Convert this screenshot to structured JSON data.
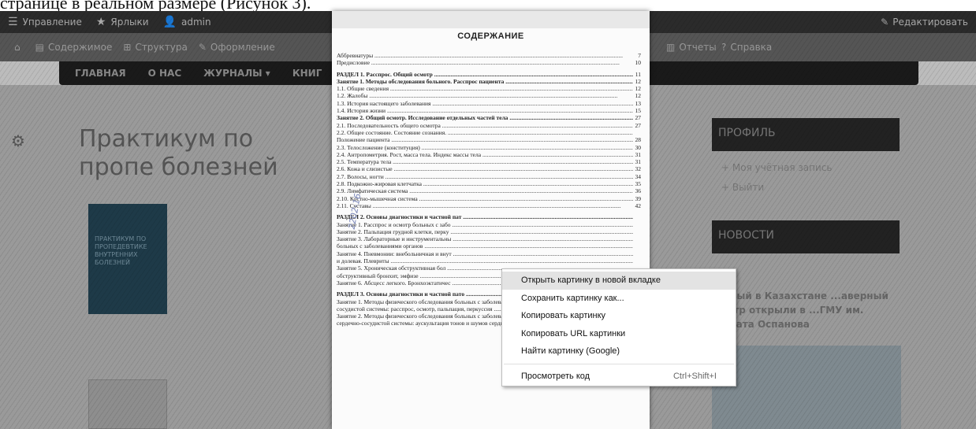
{
  "caption": "странице в реальном размере (Рисунок 3).",
  "admin_toolbar": {
    "items": [
      {
        "icon": "hamburger-icon",
        "label": "Управление"
      },
      {
        "icon": "star-icon",
        "label": "Ярлыки"
      },
      {
        "icon": "user-icon",
        "label": "admin"
      }
    ],
    "edit": {
      "icon": "pencil-icon",
      "label": "Редактировать"
    }
  },
  "admin_tabs": {
    "left": [
      {
        "icon": "home-icon",
        "label": ""
      },
      {
        "icon": "content-icon",
        "label": "Содержимое"
      },
      {
        "icon": "structure-icon",
        "label": "Структура"
      },
      {
        "icon": "appearance-icon",
        "label": "Оформление"
      }
    ],
    "right": [
      {
        "icon": "reports-icon",
        "label": "Отчеты"
      },
      {
        "icon": "help-icon",
        "label": "Справка"
      }
    ]
  },
  "site_nav": [
    "ГЛАВНАЯ",
    "О НАС",
    "ЖУРНАЛЫ ▾",
    "КНИГ"
  ],
  "page_title": "Практикум по пропедевтике внутренних болезней",
  "page_title_visible": "Практикум по пропе болезней",
  "book_cover_text": "ПРАКТИКУМ ПО ПРОПЕДЕВТИКЕ ВНУТРЕННИХ БОЛЕЗНЕЙ",
  "sidebar": {
    "profile_heading": "ПРОФИЛЬ",
    "profile_links": [
      "+ Моя учётная запись",
      "+ Выйти"
    ],
    "news_heading": "НОВОСТИ",
    "news_text": "...овый в Казахстане ...аверный центр открыли в ...ГМУ им. Марата Оспанова"
  },
  "toc": {
    "title": "СОДЕРЖАНИЕ",
    "stamp": "2202-16",
    "lines": [
      {
        "text": "Аббревиатуры",
        "page": "7",
        "cls": ""
      },
      {
        "text": "Предисловие",
        "page": "10",
        "cls": ""
      },
      {
        "text": "РАЗДЕЛ 1. Расспрос. Общий осмотр",
        "page": "11",
        "cls": "gap"
      },
      {
        "text": "Занятие 1. Методы обследования больного. Расспрос пациента",
        "page": "12",
        "cls": ""
      },
      {
        "text": "   1.1. Общие сведения",
        "page": "12",
        "cls": ""
      },
      {
        "text": "   1.2. Жалобы",
        "page": "12",
        "cls": ""
      },
      {
        "text": "   1.3. История настоящего заболевания",
        "page": "13",
        "cls": ""
      },
      {
        "text": "   1.4. История жизни",
        "page": "15",
        "cls": ""
      },
      {
        "text": "Занятие 2. Общий осмотр. Исследование отдельных частей тела",
        "page": "27",
        "cls": ""
      },
      {
        "text": "   2.1. Последовательность общего осмотра",
        "page": "27",
        "cls": ""
      },
      {
        "text": "   2.2. Общее состояние. Состояние сознания.",
        "page": "",
        "cls": ""
      },
      {
        "text": "         Положение пациента",
        "page": "28",
        "cls": ""
      },
      {
        "text": "   2.3. Телосложение (конституция)",
        "page": "30",
        "cls": ""
      },
      {
        "text": "   2.4. Антропометрия. Рост, масса тела. Индекс массы тела",
        "page": "31",
        "cls": ""
      },
      {
        "text": "   2.5. Температура тела",
        "page": "31",
        "cls": ""
      },
      {
        "text": "   2.6. Кожа и слизистые",
        "page": "32",
        "cls": ""
      },
      {
        "text": "   2.7. Волосы, ногти",
        "page": "34",
        "cls": ""
      },
      {
        "text": "   2.8. Подкожно-жировая клетчатка",
        "page": "35",
        "cls": ""
      },
      {
        "text": "   2.9. Лимфатическая система",
        "page": "36",
        "cls": ""
      },
      {
        "text": "   2.10. Костно-мышечная система",
        "page": "39",
        "cls": ""
      },
      {
        "text": "   2.11. Суставы",
        "page": "42",
        "cls": ""
      },
      {
        "text": "РАЗДЕЛ 2. Основы диагностики и частной пат",
        "page": "",
        "cls": "gap"
      },
      {
        "text": "Занятие 1. Расспрос и осмотр больных с забо",
        "page": "",
        "cls": ""
      },
      {
        "text": "Занятие 2. Пальпация грудной клетки, перку",
        "page": "",
        "cls": ""
      },
      {
        "text": "Занятие 3. Лабораторные и инструментальны",
        "page": "",
        "cls": ""
      },
      {
        "text": "            больных с заболеваниями органов",
        "page": "",
        "cls": ""
      },
      {
        "text": "Занятие 4. Пневмонии: внебольничная и внут",
        "page": "",
        "cls": ""
      },
      {
        "text": "            и долевая. Плевриты",
        "page": "",
        "cls": ""
      },
      {
        "text": "Занятие 5. Хроническая обструктивная бол",
        "page": "",
        "cls": ""
      },
      {
        "text": "            обструктивный бронхит, эмфизе",
        "page": "",
        "cls": ""
      },
      {
        "text": "Занятие 6. Абсцесс легкого. Бронхоэктатичес",
        "page": "",
        "cls": ""
      },
      {
        "text": "РАЗДЕЛ 3. Основы диагностики и частной пато",
        "page": "",
        "cls": "gap"
      },
      {
        "text": "Занятие 1. Методы физического обследования больных с заболеваниями сердечно-",
        "page": "",
        "cls": ""
      },
      {
        "text": "            сосудистой системы: расспрос, осмотр, пальпация, перкуссия",
        "page": "66",
        "cls": ""
      },
      {
        "text": "Занятие 2. Методы физического обследования больных с заболеваниями",
        "page": "",
        "cls": ""
      },
      {
        "text": "            сердечно-сосудистой системы: аускультация тонов и шумов сердца",
        "page": "72",
        "cls": ""
      }
    ]
  },
  "context_menu": {
    "items": [
      {
        "label": "Открыть картинку в новой вкладке",
        "shortcut": "",
        "highlighted": true
      },
      {
        "label": "Сохранить картинку как...",
        "shortcut": "",
        "highlighted": false
      },
      {
        "label": "Копировать картинку",
        "shortcut": "",
        "highlighted": false
      },
      {
        "label": "Копировать URL картинки",
        "shortcut": "",
        "highlighted": false
      },
      {
        "label": "Найти картинку (Google)",
        "shortcut": "",
        "highlighted": false
      }
    ],
    "inspect": {
      "label": "Просмотреть код",
      "shortcut": "Ctrl+Shift+I"
    }
  }
}
